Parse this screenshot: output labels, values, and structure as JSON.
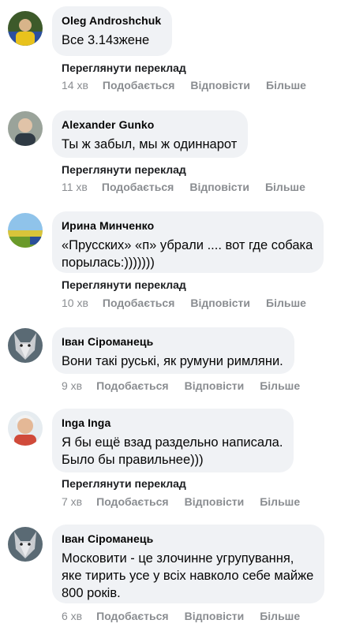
{
  "labels": {
    "translate": "Переглянути переклад",
    "like": "Подобається",
    "reply": "Відповісти",
    "more": "Більше"
  },
  "comments": [
    {
      "author": "Oleg Androshchuk",
      "text": "Все 3.14зжене",
      "time": "14 хв",
      "show_translate": true
    },
    {
      "author": "Alexander Gunko",
      "text": "Ты ж забыл, мы ж одиннарот",
      "time": "11 хв",
      "show_translate": true
    },
    {
      "author": "Ирина Минченко",
      "text": "«Прусских» «п» убрали .... вот где собака\nпорылась:)))))))",
      "time": "10 хв",
      "show_translate": true
    },
    {
      "author": "Іван Сіроманець",
      "text": "Вони такі руські, як румуни римляни.",
      "time": "9 хв",
      "show_translate": false
    },
    {
      "author": "Inga Inga",
      "text": "Я бы ещё взад раздельно написала.\nБыло бы правильнее)))",
      "time": "7 хв",
      "show_translate": true
    },
    {
      "author": "Іван Сіроманець",
      "text": "Московити - це злочинне угрупування,\nяке тирить усе у всіх навколо себе майже\n800 років.",
      "time": "6 хв",
      "show_translate": false
    }
  ]
}
